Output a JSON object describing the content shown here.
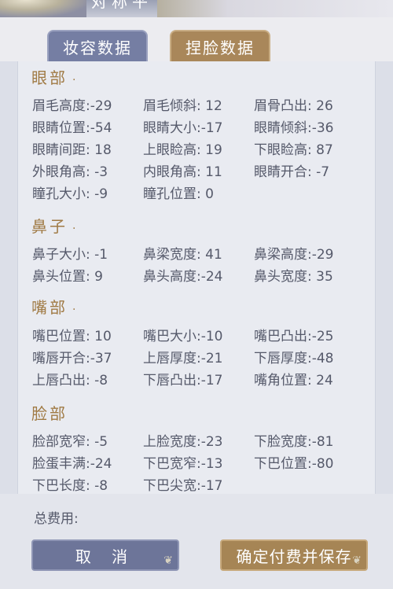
{
  "header": {
    "title": "对称平"
  },
  "tabs": {
    "makeup": "妆容数据",
    "face": "捏脸数据"
  },
  "sections": {
    "eyes": {
      "title": "眼部",
      "dot": "·",
      "items": [
        "眉毛高度:-29",
        "眉毛倾斜: 12",
        "眉骨凸出: 26",
        "眼睛位置:-54",
        "眼睛大小:-17",
        "眼睛倾斜:-36",
        "眼睛间距: 18",
        "上眼睑高: 19",
        "下眼睑高: 87",
        "外眼角高: -3",
        "内眼角高: 11",
        "眼睛开合: -7",
        "瞳孔大小: -9",
        "瞳孔位置: 0"
      ]
    },
    "nose": {
      "title": "鼻子",
      "dot": "·",
      "items": [
        "鼻子大小: -1",
        "鼻梁宽度: 41",
        "鼻梁高度:-29",
        "鼻头位置: 9",
        "鼻头高度:-24",
        "鼻头宽度: 35"
      ]
    },
    "mouth": {
      "title": "嘴部",
      "dot": "·",
      "items": [
        "嘴巴位置: 10",
        "嘴巴大小:-10",
        "嘴巴凸出:-25",
        "嘴唇开合:-37",
        "上唇厚度:-21",
        "下唇厚度:-48",
        "上唇凸出: -8",
        "下唇凸出:-17",
        "嘴角位置: 24"
      ]
    },
    "face": {
      "title": "脸部",
      "items": [
        "脸部宽窄: -5",
        "上脸宽度:-23",
        "下脸宽度:-81",
        "脸蛋丰满:-24",
        "下巴宽窄:-13",
        "下巴位置:-80",
        "下巴长度: -8",
        "下巴尖宽:-17"
      ]
    }
  },
  "footer": {
    "total_label": "总费用:",
    "cancel_label": "取 消",
    "confirm_label": "确定付费并保存"
  }
}
